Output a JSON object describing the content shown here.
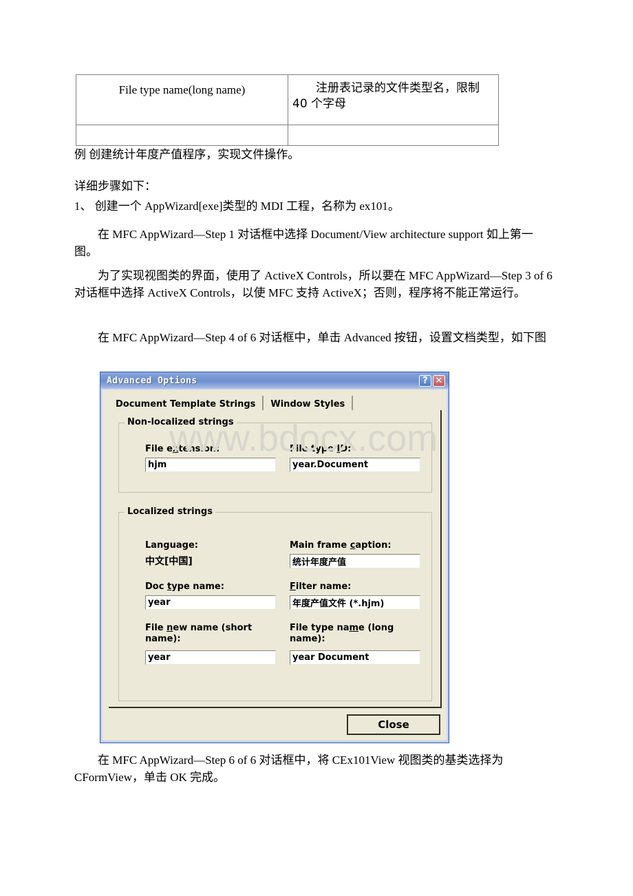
{
  "document": {
    "table": {
      "rows": [
        {
          "left": "File type name(long name)",
          "right": "注册表记录的文件类型名，限制 40 个字母"
        },
        {
          "left": "",
          "right": ""
        }
      ]
    },
    "paragraphs": {
      "p1": "例 创建统计年度产值程序，实现文件操作。",
      "p2": "详细步骤如下：",
      "p3": "1、 创建一个 AppWizard[exe]类型的 MDI 工程，名称为 ex101。",
      "p4": "在 MFC AppWizard—Step 1 对话框中选择 Document/View architecture support 如上第一图。",
      "p5": "为了实现视图类的界面，使用了 ActiveX Controls，所以要在 MFC AppWizard—Step 3 of 6 对话框中选择 ActiveX Controls，以使 MFC 支持 ActiveX；否则，程序将不能正常运行。",
      "p6": "在 MFC AppWizard—Step 4 of 6 对话框中，单击 Advanced 按钮，设置文档类型，如下图",
      "p7": "在 MFC AppWizard—Step 6 of 6 对话框中，将 CEx101View 视图类的基类选择为CFormView，单击 OK 完成。"
    },
    "watermark": "www.bdocx.com"
  },
  "dialog": {
    "title": "Advanced Options",
    "titlebar_buttons": {
      "help": "?",
      "close": "✕"
    },
    "tabs": [
      {
        "label": "Document Template Strings",
        "active": true
      },
      {
        "label": "Window Styles",
        "active": false
      }
    ],
    "groups": {
      "nonlocalized": {
        "title": "Non-localized strings",
        "fields": [
          {
            "label_html": "File e<u>x</u>tension:",
            "value": "hjm"
          },
          {
            "label_html": "File type <u>I</u>D:",
            "value": "year.Document"
          }
        ]
      },
      "localized": {
        "title": "Localized strings",
        "fields": [
          {
            "label_html": "Language:",
            "value": "中文[中国]",
            "static": true
          },
          {
            "label_html": "Main frame <u>c</u>aption:",
            "value": "统计年度产值"
          },
          {
            "label_html": "Doc <u>t</u>ype name:",
            "value": "year"
          },
          {
            "label_html": "<u>F</u>ilter name:",
            "value": "年度产值文件 (*.hjm)"
          },
          {
            "label_html": "File <u>n</u>ew name (short\nname):",
            "value": "year"
          },
          {
            "label_html": "File type na<u>m</u>e (long\nname):",
            "value": "year Document"
          }
        ]
      }
    },
    "close_button": "Close"
  },
  "colors": {
    "dialog_face": "#ece9d8",
    "titlebar_blue": "#6e8fd0",
    "titlebar_border": "#2d5fb0",
    "close_btn_red": "#c05a5a",
    "help_btn_blue": "#4a7cc8",
    "watermark_gray": "#d8d6cc",
    "table_border": "#808080"
  }
}
